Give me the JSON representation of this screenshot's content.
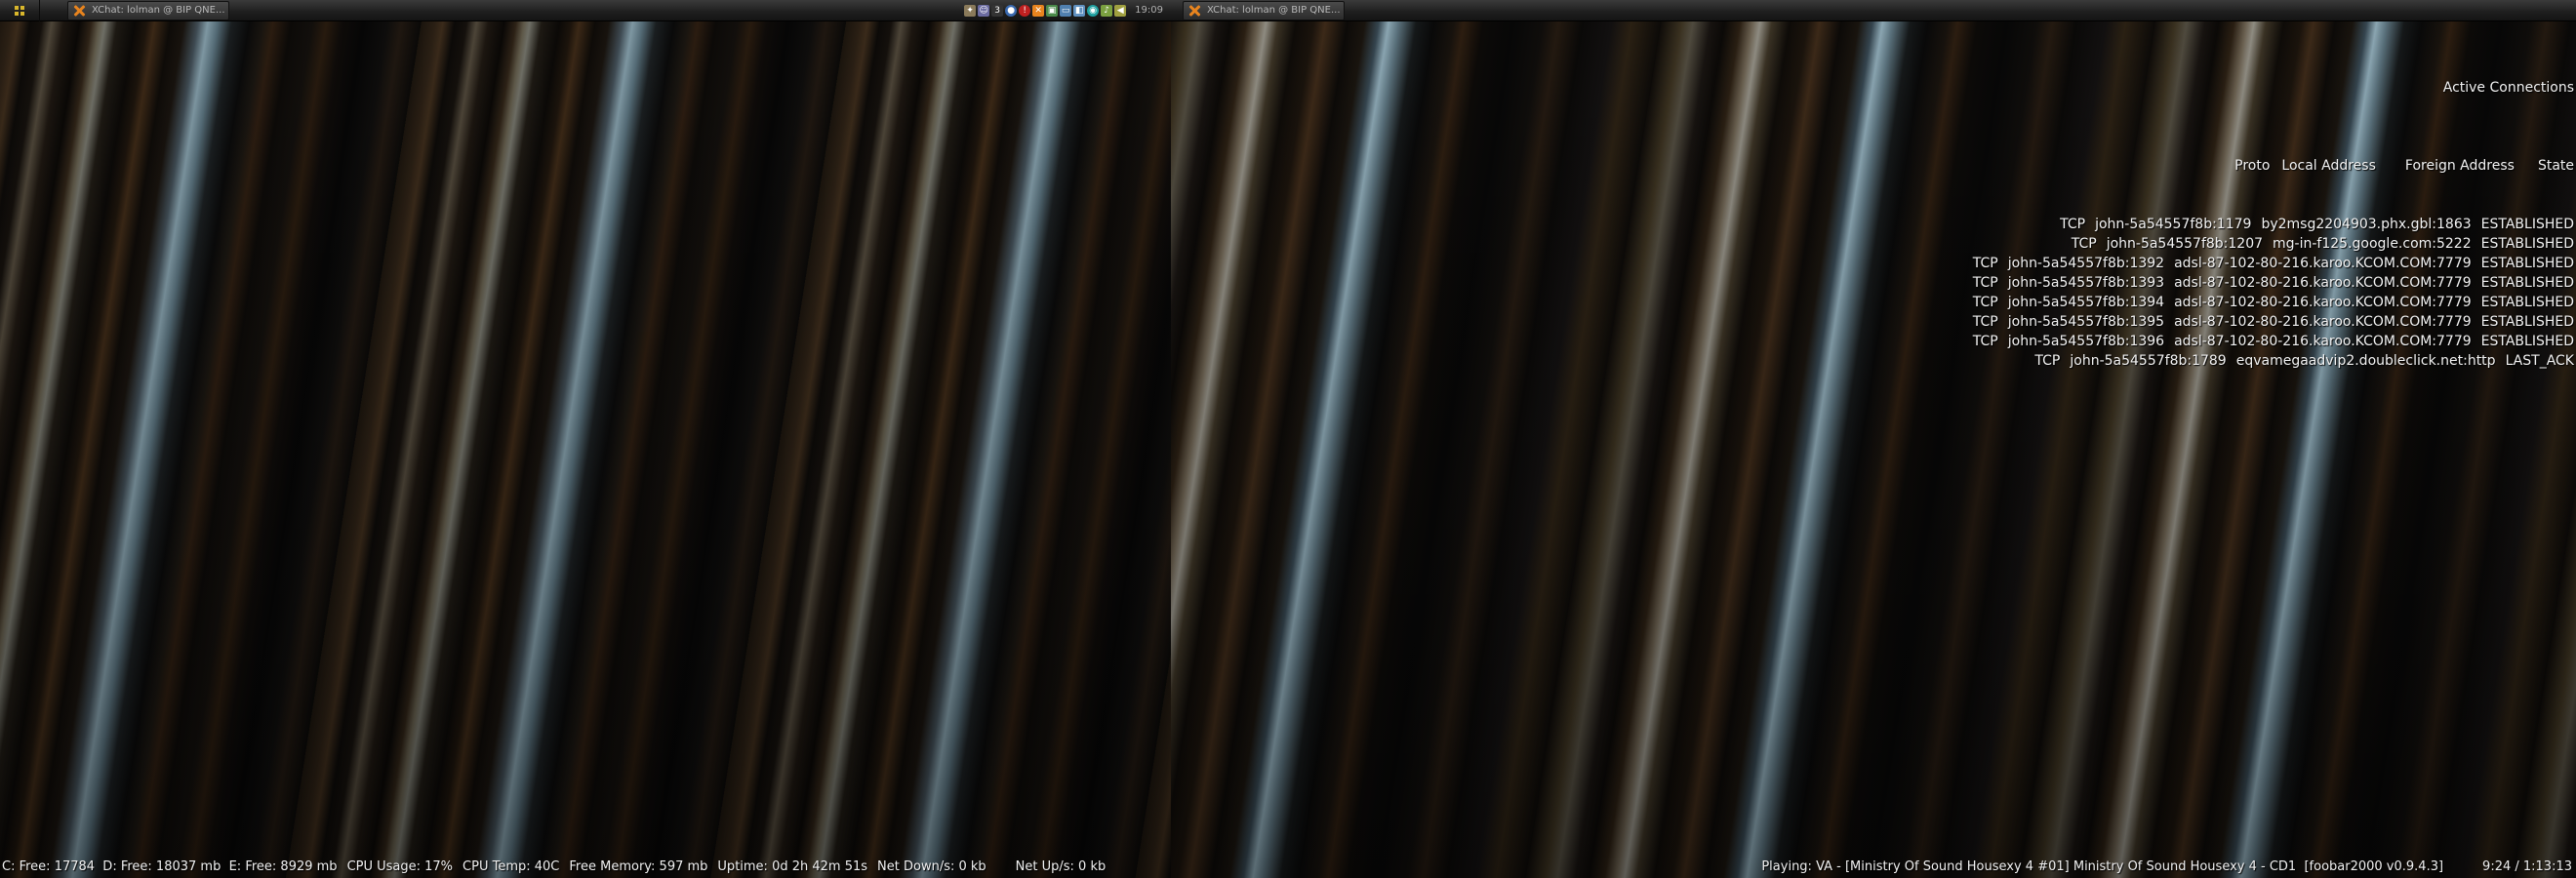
{
  "taskbar_left": {
    "task_label": "XChat: lolman @ BIP QNE...",
    "clock": "19:09",
    "tray_icons": [
      "shield-icon",
      "user-icon",
      "number-icon",
      "globe-icon",
      "alert-icon",
      "xchat-tray-icon",
      "network-icon",
      "monitor-icon",
      "chat-icon",
      "steam-icon",
      "volume-icon",
      "speaker-icon"
    ]
  },
  "taskbar_right": {
    "task_label": "XChat: lolman @ BIP QNE..."
  },
  "connections": {
    "title": "Active Connections",
    "header": {
      "proto": "Proto",
      "local": "Local Address",
      "foreign": "Foreign Address",
      "state": "State"
    },
    "rows": [
      {
        "proto": "TCP",
        "local": "john-5a54557f8b:1179",
        "foreign": "by2msg2204903.phx.gbl:1863",
        "state": "ESTABLISHED"
      },
      {
        "proto": "TCP",
        "local": "john-5a54557f8b:1207",
        "foreign": "mg-in-f125.google.com:5222",
        "state": "ESTABLISHED"
      },
      {
        "proto": "TCP",
        "local": "john-5a54557f8b:1392",
        "foreign": "adsl-87-102-80-216.karoo.KCOM.COM:7779",
        "state": "ESTABLISHED"
      },
      {
        "proto": "TCP",
        "local": "john-5a54557f8b:1393",
        "foreign": "adsl-87-102-80-216.karoo.KCOM.COM:7779",
        "state": "ESTABLISHED"
      },
      {
        "proto": "TCP",
        "local": "john-5a54557f8b:1394",
        "foreign": "adsl-87-102-80-216.karoo.KCOM.COM:7779",
        "state": "ESTABLISHED"
      },
      {
        "proto": "TCP",
        "local": "john-5a54557f8b:1395",
        "foreign": "adsl-87-102-80-216.karoo.KCOM.COM:7779",
        "state": "ESTABLISHED"
      },
      {
        "proto": "TCP",
        "local": "john-5a54557f8b:1396",
        "foreign": "adsl-87-102-80-216.karoo.KCOM.COM:7779",
        "state": "ESTABLISHED"
      },
      {
        "proto": "TCP",
        "local": "john-5a54557f8b:1789",
        "foreign": "eqvamegaadvip2.doubleclick.net:http",
        "state": "LAST_ACK"
      }
    ]
  },
  "status_left": {
    "drives": "C: Free: 17784  D: Free: 18037 mb  E: Free: 8929 mb",
    "cpu_usage": "CPU Usage: 17%",
    "cpu_temp": "CPU Temp: 40C",
    "free_memory": "Free Memory: 597 mb",
    "uptime": "Uptime: 0d 2h 42m 51s",
    "net_down": "Net Down/s: 0 kb",
    "net_up": "Net Up/s: 0 kb"
  },
  "status_right": {
    "playing": "Playing: VA - [Ministry Of Sound Housexy 4 #01] Ministry Of Sound Housexy 4 - CD1  [foobar2000 v0.9.4.3]",
    "time": "9:24 / 1:13:13"
  }
}
